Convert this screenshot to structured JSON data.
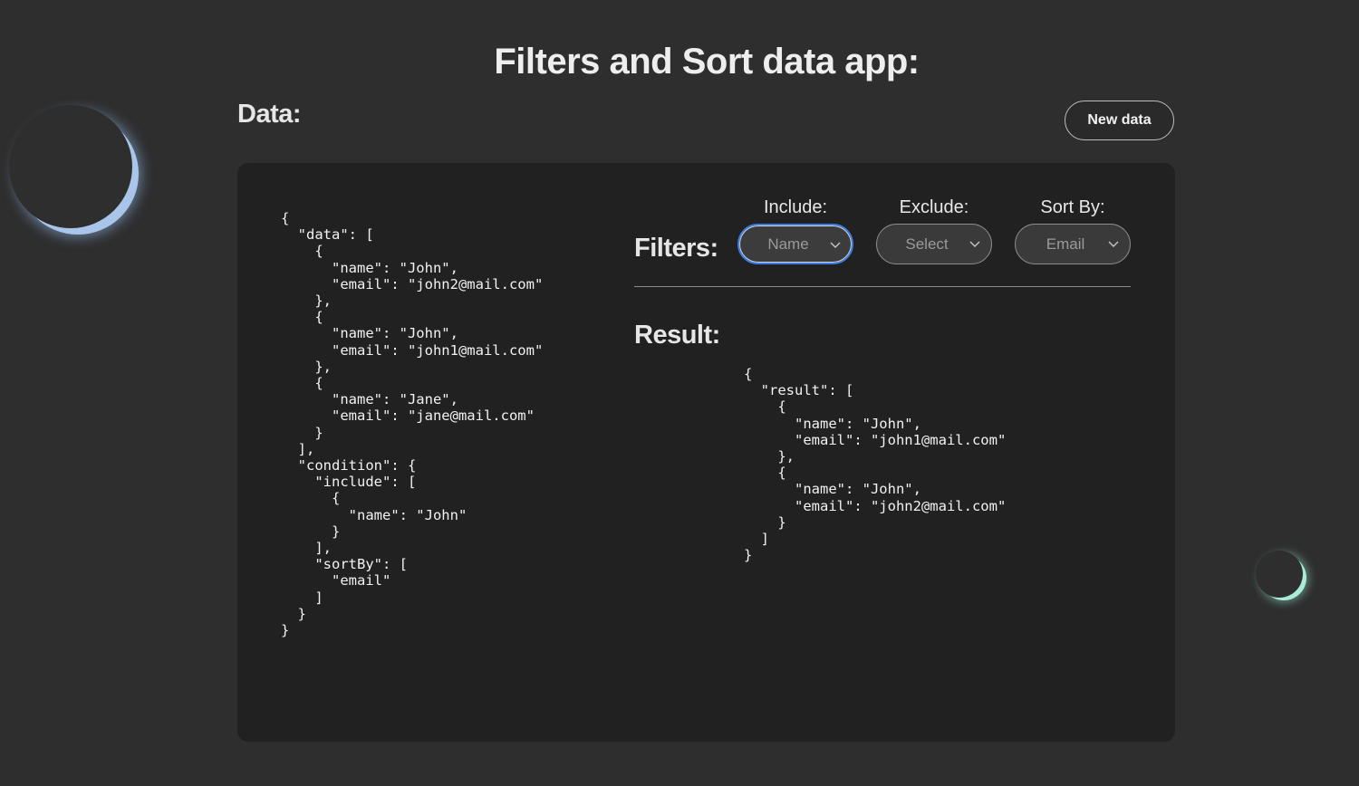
{
  "app": {
    "title": "Filters and Sort data app:"
  },
  "data_section": {
    "heading": "Data:",
    "new_data_label": "New data",
    "json": "{\n  \"data\": [\n    {\n      \"name\": \"John\",\n      \"email\": \"john2@mail.com\"\n    },\n    {\n      \"name\": \"John\",\n      \"email\": \"john1@mail.com\"\n    },\n    {\n      \"name\": \"Jane\",\n      \"email\": \"jane@mail.com\"\n    }\n  ],\n  \"condition\": {\n    \"include\": [\n      {\n        \"name\": \"John\"\n      }\n    ],\n    \"sortBy\": [\n      \"email\"\n    ]\n  }\n}"
  },
  "filters": {
    "heading": "Filters:",
    "include": {
      "label": "Include:",
      "value": "Name"
    },
    "exclude": {
      "label": "Exclude:",
      "value": "Select"
    },
    "sort_by": {
      "label": "Sort By:",
      "value": "Email"
    }
  },
  "result_section": {
    "heading": "Result:",
    "json": "{\n  \"result\": [\n    {\n      \"name\": \"John\",\n      \"email\": \"john1@mail.com\"\n    },\n    {\n      \"name\": \"John\",\n      \"email\": \"john2@mail.com\"\n    }\n  ]\n}"
  },
  "decor": {
    "moon_large_glow": "#a9c6ea",
    "moon_small_glow": "#a9ebd7",
    "focus_color": "#3f7ce0"
  }
}
